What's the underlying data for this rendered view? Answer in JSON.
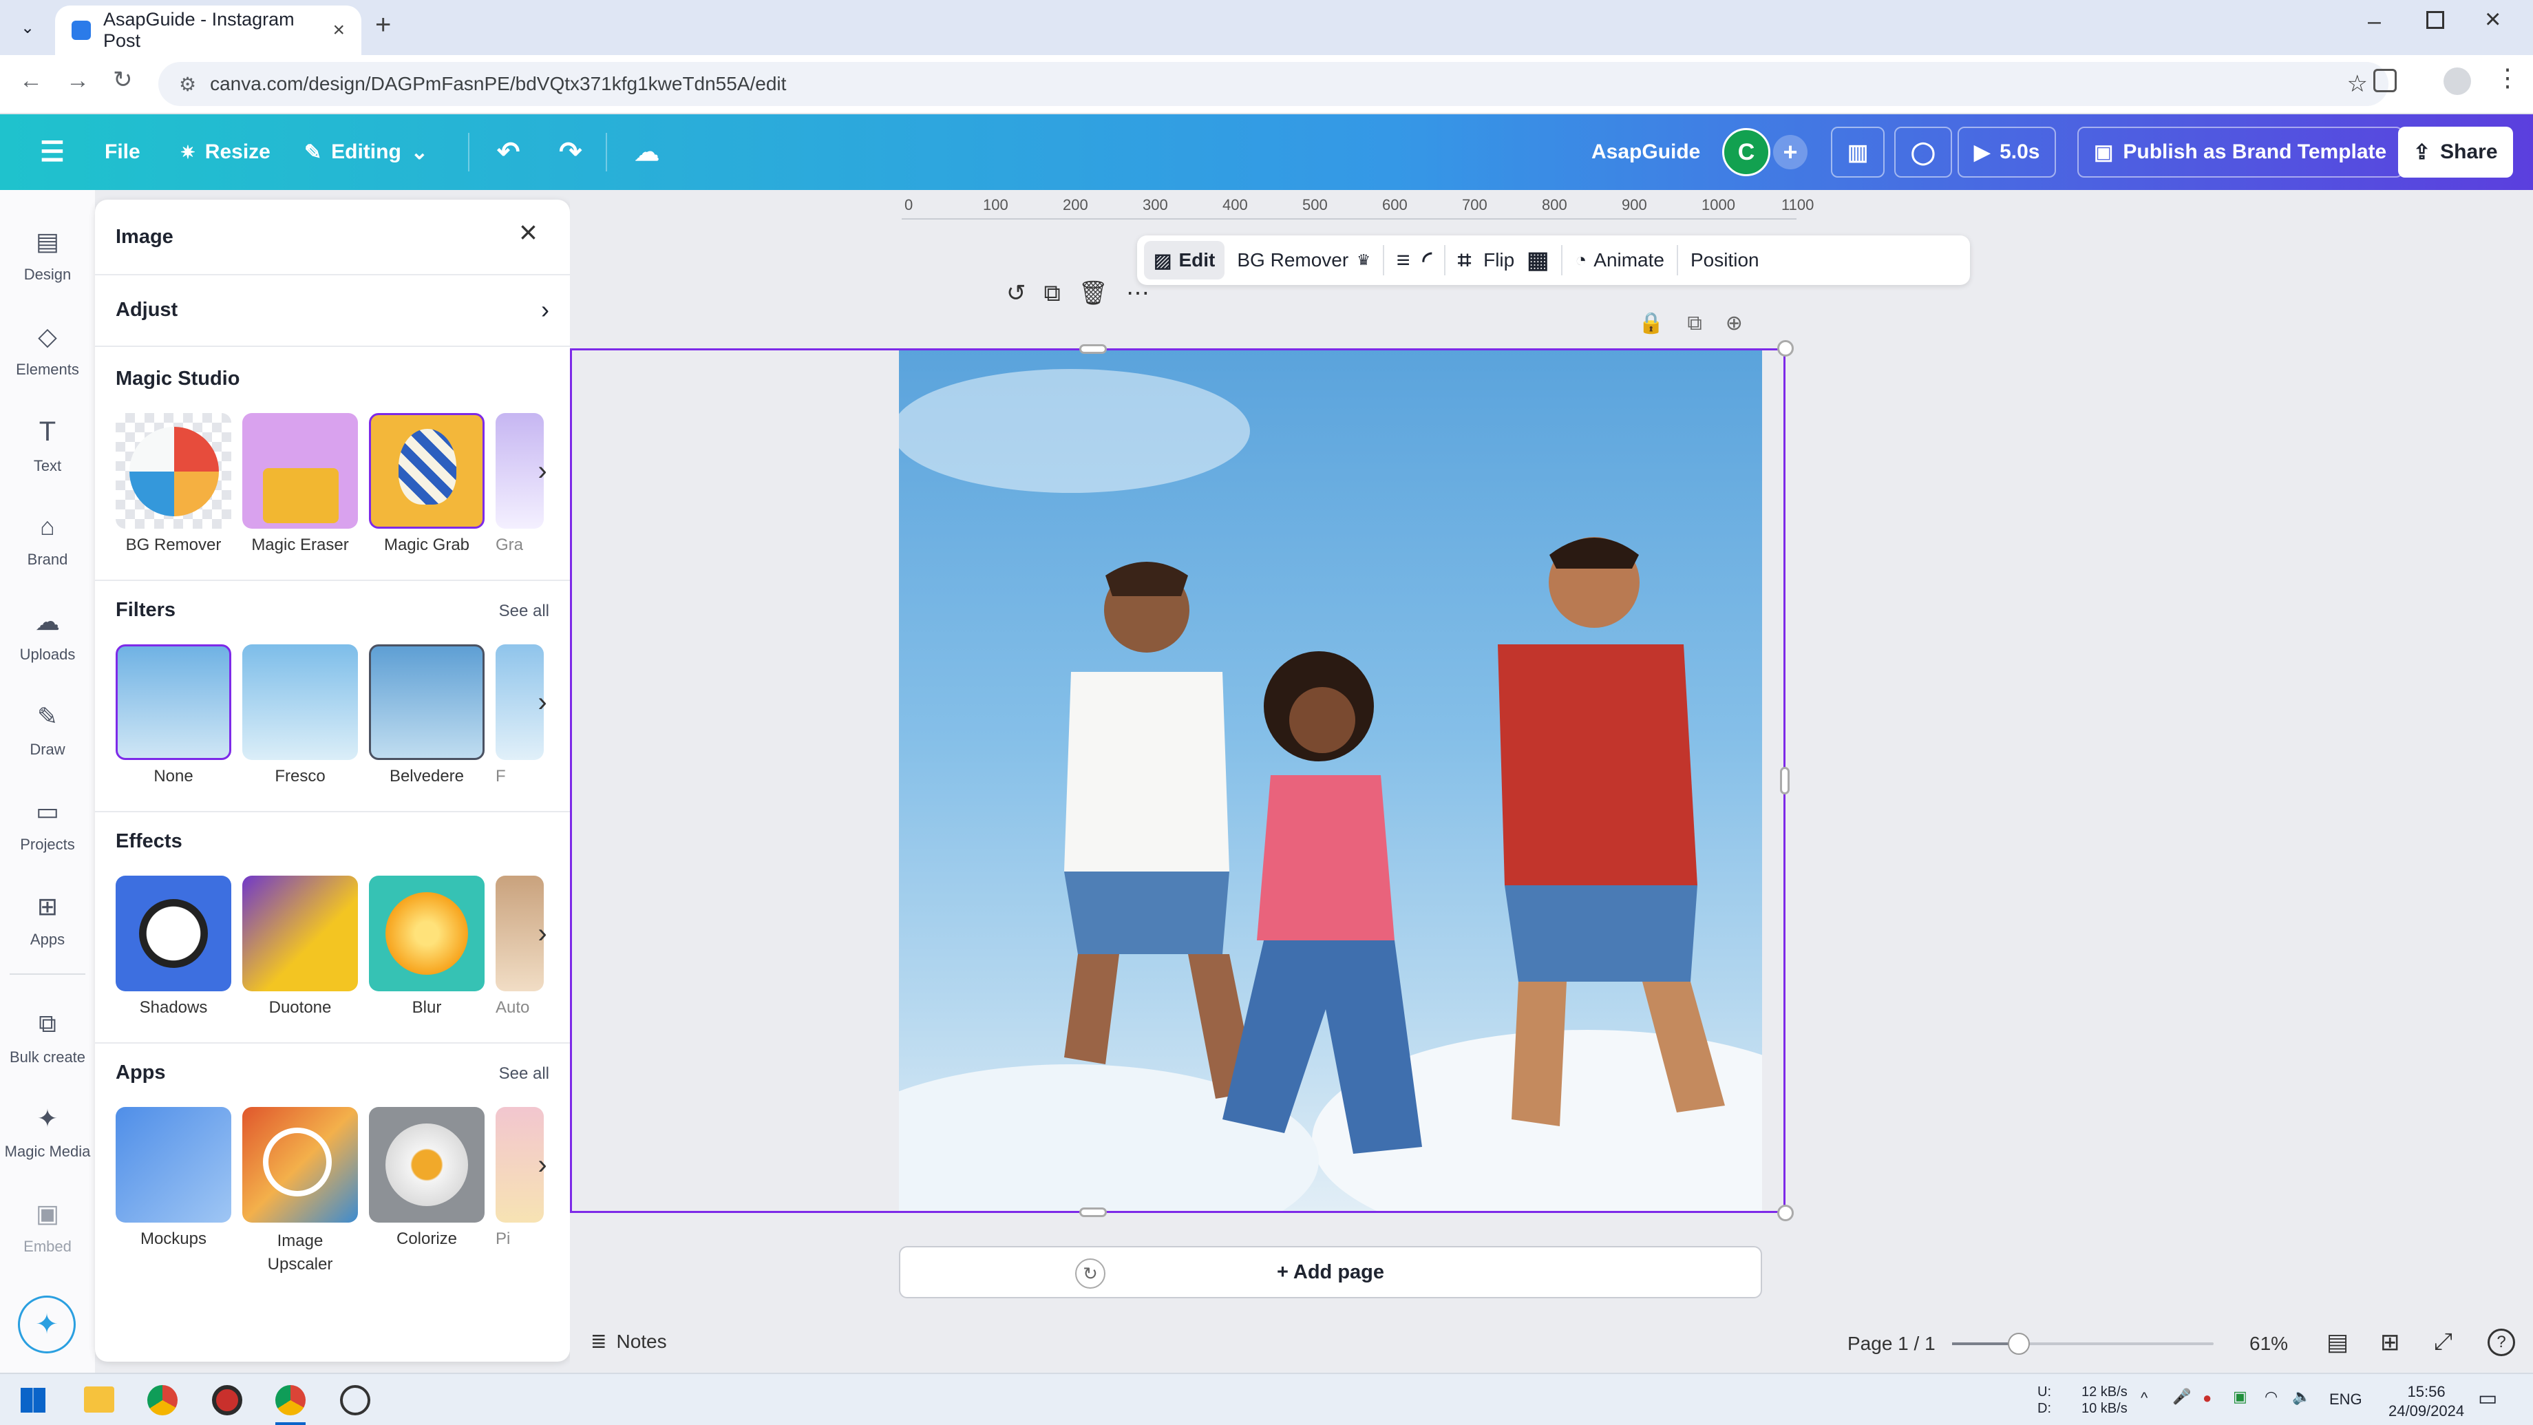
{
  "browser": {
    "tab_title": "AsapGuide - Instagram Post",
    "url": "canva.com/design/DAGPmFasnPE/bdVQtx371kfg1kweTdn55A/edit"
  },
  "header": {
    "file": "File",
    "resize": "Resize",
    "editing": "Editing",
    "brand_name": "AsapGuide",
    "avatar_initial": "C",
    "play_duration": "5.0s",
    "publish": "Publish as Brand Template",
    "share": "Share"
  },
  "rail": [
    {
      "label": "Design"
    },
    {
      "label": "Elements"
    },
    {
      "label": "Text"
    },
    {
      "label": "Brand"
    },
    {
      "label": "Uploads"
    },
    {
      "label": "Draw"
    },
    {
      "label": "Projects"
    },
    {
      "label": "Apps"
    },
    {
      "label": "Bulk create"
    },
    {
      "label": "Magic Media"
    },
    {
      "label": "Embed"
    }
  ],
  "panel": {
    "title": "Image",
    "adjust": "Adjust",
    "magic_studio": {
      "title": "Magic Studio",
      "items": [
        "BG Remover",
        "Magic Eraser",
        "Magic Grab",
        "Gra"
      ]
    },
    "filters": {
      "title": "Filters",
      "see_all": "See all",
      "items": [
        "None",
        "Fresco",
        "Belvedere",
        "F"
      ]
    },
    "effects": {
      "title": "Effects",
      "items": [
        "Shadows",
        "Duotone",
        "Blur",
        "Auto"
      ]
    },
    "apps": {
      "title": "Apps",
      "see_all": "See all",
      "items": [
        "Mockups",
        "Image Upscaler",
        "Colorize",
        "Pi"
      ]
    }
  },
  "ruler": [
    "0",
    "100",
    "200",
    "300",
    "400",
    "500",
    "600",
    "700",
    "800",
    "900",
    "1000",
    "1100"
  ],
  "toolbar": {
    "edit": "Edit",
    "bg_remover": "BG Remover",
    "flip": "Flip",
    "animate": "Animate",
    "position": "Position"
  },
  "canvas": {
    "add_page": "+ Add page"
  },
  "bottom": {
    "notes": "Notes",
    "page": "Page 1 / 1",
    "zoom": "61%",
    "zoom_level": 0.61
  },
  "taskbar": {
    "net_up": "12 kB/s",
    "net_down": "10 kB/s",
    "net_up_label": "U:",
    "net_down_label": "D:",
    "lang": "ENG",
    "time": "15:56",
    "date": "24/09/2024"
  },
  "colors": {
    "accent": "#7d2ae8",
    "header_start": "#1fc2cd",
    "header_end": "#5b3fde"
  }
}
